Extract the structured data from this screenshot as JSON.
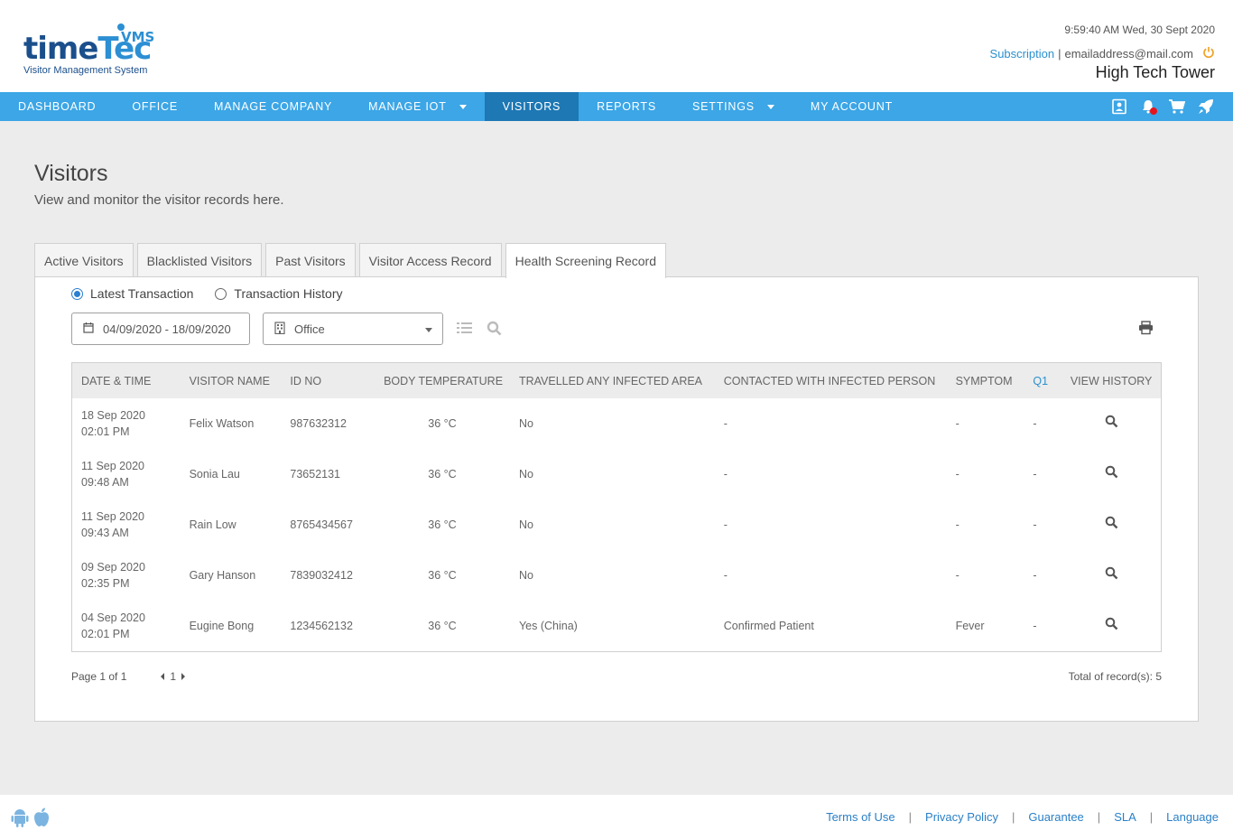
{
  "header": {
    "logo": {
      "main_a": "time",
      "main_b": "Tec",
      "badge": "VMS",
      "tagline": "Visitor Management System"
    },
    "datetime": "9:59:40 AM  Wed, 30 Sept 2020",
    "subscription": "Subscription",
    "separator": "|",
    "email": "emailaddress@mail.com",
    "company": "High Tech Tower"
  },
  "nav": {
    "items": [
      {
        "label": "DASHBOARD"
      },
      {
        "label": "OFFICE"
      },
      {
        "label": "MANAGE COMPANY"
      },
      {
        "label": "MANAGE IOT"
      },
      {
        "label": "VISITORS"
      },
      {
        "label": "REPORTS"
      },
      {
        "label": "SETTINGS"
      },
      {
        "label": "MY ACCOUNT"
      }
    ],
    "active": "VISITORS",
    "icons": [
      "contact-card-icon",
      "notification-bell-icon",
      "cart-icon",
      "rocket-icon"
    ]
  },
  "page": {
    "title": "Visitors",
    "subtitle": "View and monitor the visitor records here."
  },
  "tabs": [
    {
      "label": "Active Visitors"
    },
    {
      "label": "Blacklisted Visitors"
    },
    {
      "label": "Past Visitors"
    },
    {
      "label": "Visitor Access Record"
    },
    {
      "label": "Health Screening Record"
    }
  ],
  "filters": {
    "radio_latest": "Latest Transaction",
    "radio_history": "Transaction History",
    "selected_radio": "Latest Transaction",
    "date_range": "04/09/2020 - 18/09/2020",
    "office": "Office"
  },
  "table": {
    "headers": {
      "datetime": "DATE & TIME",
      "name": "VISITOR NAME",
      "id": "ID NO",
      "temp": "BODY TEMPERATURE",
      "travel": "TRAVELLED ANY INFECTED AREA",
      "contact": "CONTACTED WITH INFECTED PERSON",
      "symptom": "SYMPTOM",
      "q1": "Q1",
      "history": "VIEW HISTORY"
    },
    "rows": [
      {
        "date": "18 Sep 2020",
        "time": "02:01 PM",
        "name": "Felix Watson",
        "id": "987632312",
        "temp": "36 °C",
        "travel": "No",
        "contact": "-",
        "symptom": "-",
        "q1": "-"
      },
      {
        "date": "11 Sep 2020",
        "time": "09:48 AM",
        "name": "Sonia Lau",
        "id": "73652131",
        "temp": "36 °C",
        "travel": "No",
        "contact": "-",
        "symptom": "-",
        "q1": "-"
      },
      {
        "date": "11 Sep 2020",
        "time": "09:43 AM",
        "name": "Rain Low",
        "id": "8765434567",
        "temp": "36 °C",
        "travel": "No",
        "contact": "-",
        "symptom": "-",
        "q1": "-"
      },
      {
        "date": "09 Sep 2020",
        "time": "02:35 PM",
        "name": "Gary Hanson",
        "id": "7839032412",
        "temp": "36 °C",
        "travel": "No",
        "contact": "-",
        "symptom": "-",
        "q1": "-"
      },
      {
        "date": "04 Sep 2020",
        "time": "02:01 PM",
        "name": "Eugine Bong",
        "id": "1234562132",
        "temp": "36 °C",
        "travel": "Yes (China)",
        "contact": "Confirmed Patient",
        "symptom": "Fever",
        "q1": "-"
      }
    ]
  },
  "pagination": {
    "page_text": "Page 1 of 1",
    "current": "1",
    "total_text": "Total of record(s): 5"
  },
  "footer": {
    "links": [
      {
        "label": "Terms of Use"
      },
      {
        "label": "Privacy Policy"
      },
      {
        "label": "Guarantee"
      },
      {
        "label": "SLA"
      },
      {
        "label": "Language"
      }
    ],
    "separator": "|"
  },
  "colors": {
    "nav_bg": "#3ca6e6",
    "nav_active": "#1d78b4",
    "link": "#2a90cf",
    "alert_dot": "#e8141c",
    "power": "#f0a020"
  }
}
